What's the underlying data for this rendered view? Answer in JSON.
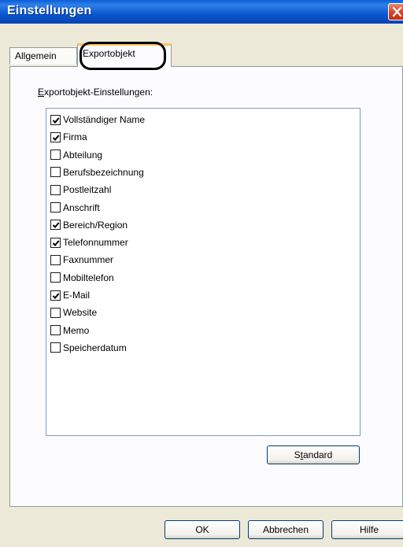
{
  "window": {
    "title": "Einstellungen"
  },
  "tabs": [
    {
      "label": "Allgemein",
      "active": false
    },
    {
      "label": "Exportobjekt",
      "active": true
    }
  ],
  "group_label": {
    "underlined": "E",
    "rest": "xportobjekt-Einstellungen:"
  },
  "fields": [
    {
      "label": "Vollständiger Name",
      "checked": true
    },
    {
      "label": "Firma",
      "checked": true
    },
    {
      "label": "Abteilung",
      "checked": false
    },
    {
      "label": "Berufsbezeichnung",
      "checked": false
    },
    {
      "label": "Postleitzahl",
      "checked": false
    },
    {
      "label": "Anschrift",
      "checked": false
    },
    {
      "label": "Bereich/Region",
      "checked": true
    },
    {
      "label": "Telefonnummer",
      "checked": true
    },
    {
      "label": "Faxnummer",
      "checked": false
    },
    {
      "label": "Mobiltelefon",
      "checked": false
    },
    {
      "label": "E-Mail",
      "checked": true
    },
    {
      "label": "Website",
      "checked": false
    },
    {
      "label": "Memo",
      "checked": false
    },
    {
      "label": "Speicherdatum",
      "checked": false
    }
  ],
  "buttons": {
    "standard": {
      "before": "S",
      "underlined": "t",
      "after": "andard"
    },
    "ok": "OK",
    "cancel": "Abbrechen",
    "help": "Hilfe"
  },
  "colors": {
    "titlebar": "#0b57d0",
    "dialog_bg": "#ece9d8",
    "tab_highlight": "#f9c35c",
    "close": "#d2432a"
  },
  "icons": {
    "close": "close-icon",
    "check": "checkmark-icon"
  }
}
